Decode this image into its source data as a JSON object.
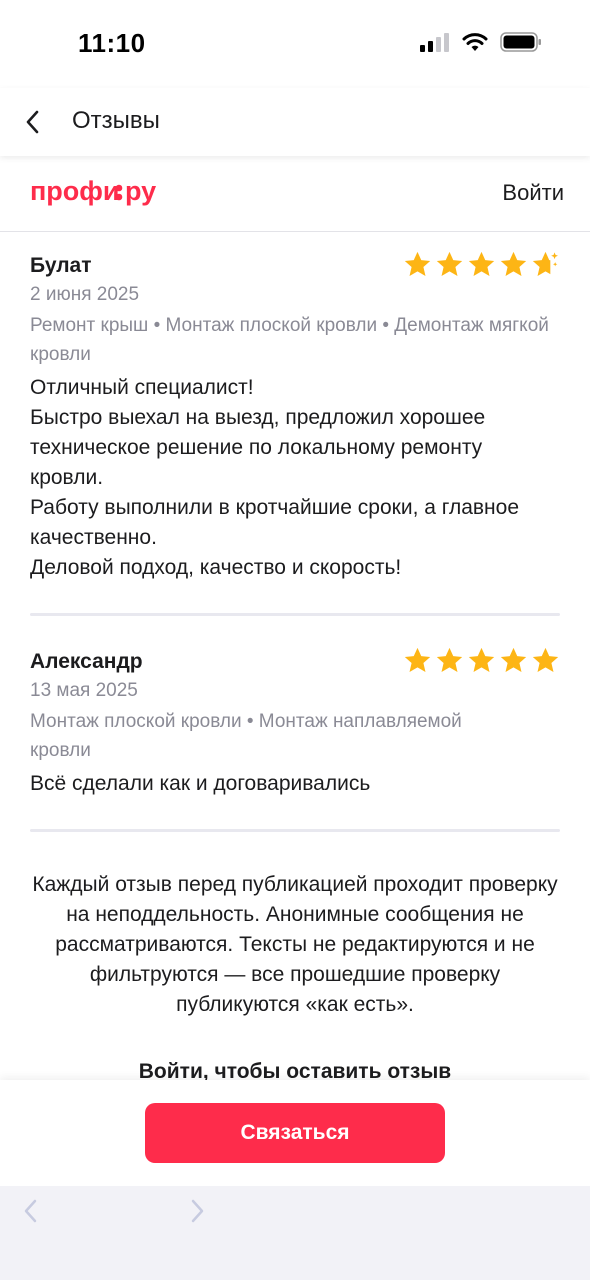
{
  "status_bar": {
    "time": "11:10"
  },
  "nav": {
    "title": "Отзывы"
  },
  "site_header": {
    "logo": "профи·ру",
    "login": "Войти"
  },
  "reviews": [
    {
      "name": "Булат",
      "date": "2 июня 2025",
      "services": "Ремонт крыш • Монтаж плоской кровли • Демонтаж мягкой кровли",
      "text": "Отличный специалист!\nБыстро выехал на выезд, предложил хорошее техническое решение по локальному ремонту кровли.\nРаботу выполнили в кротчайшие сроки, а главное качественно.\nДеловой подход, качество и скорость!",
      "rating": 4.8
    },
    {
      "name": "Александр",
      "date": "13 мая 2025",
      "services": "Монтаж плоской кровли • Монтаж наплавляемой кровли",
      "text": "Всё сделали как и договаривались",
      "rating": 5
    }
  ],
  "disclaimer": "Каждый отзыв перед публикацией проходит проверку на неподдельность. Анонимные сообщения не рассматриваются. Тексты не редактируются и не фильтруются — все прошедшие проверку публикуются «как есть».",
  "leave_review": "Войти, чтобы оставить отзыв",
  "contact_button": "Связаться",
  "colors": {
    "brand": "#fe2c4b",
    "star": "#fdb515",
    "muted": "#8a8a95"
  }
}
